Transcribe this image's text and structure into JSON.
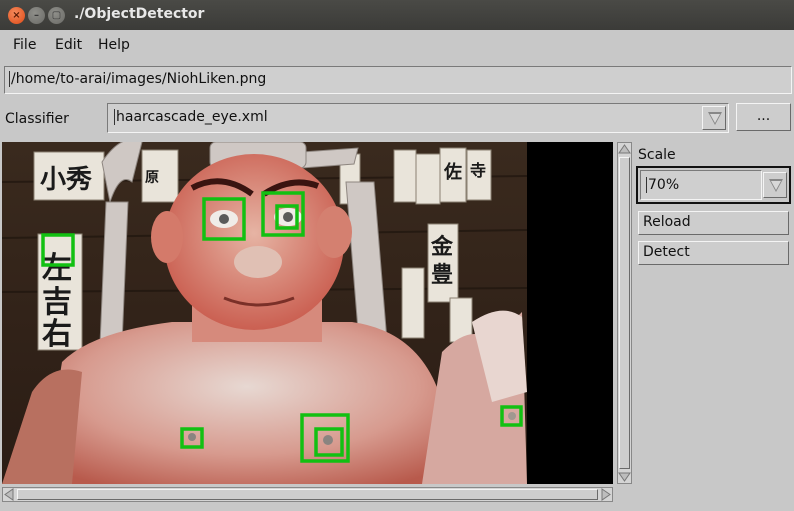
{
  "window": {
    "title": "./ObjectDetector",
    "close_glyph": "×",
    "min_glyph": "–",
    "max_glyph": "▢"
  },
  "menu": {
    "file": "File",
    "edit": "Edit",
    "help": "Help"
  },
  "path": {
    "value": "/home/to-arai/images/NiohLiken.png"
  },
  "classifier": {
    "label": "Classifier",
    "value": "haarcascade_eye.xml",
    "browse_label": "..."
  },
  "sidebar": {
    "scale_label": "Scale",
    "scale_value": "70%",
    "reload_label": "Reload",
    "detect_label": "Detect"
  },
  "image": {
    "description_icon": "statue-photo",
    "detection_color": "#12c012"
  }
}
